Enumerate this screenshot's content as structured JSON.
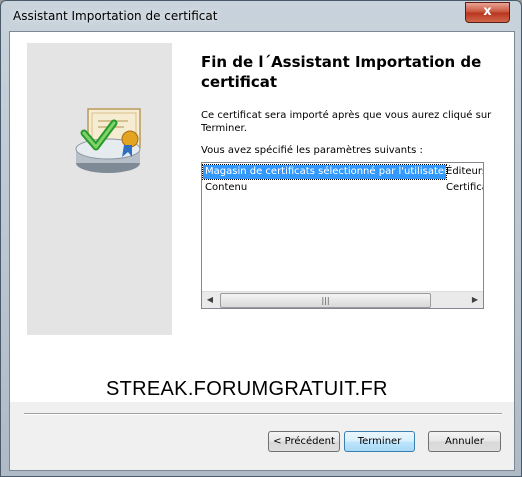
{
  "window": {
    "title": "Assistant Importation de certificat",
    "close_glyph": "x"
  },
  "wizard": {
    "heading": "Fin de l´Assistant Importation de certificat",
    "description": "Ce certificat sera importé après que vous aurez cliqué sur Terminer.",
    "params_label": "Vous avez spécifié les paramètres suivants :",
    "settings": [
      {
        "name": "Magasin de certificats sélectionné par l'utilisateur",
        "value": "Éditeurs"
      },
      {
        "name": "Contenu",
        "value": "Certificat"
      }
    ],
    "illustration_icon": "certificate-import-icon"
  },
  "watermark": "STREAK.FORUMGRATUIT.FR",
  "buttons": {
    "back": "< Précédent",
    "finish": "Terminer",
    "cancel": "Annuler"
  },
  "colors": {
    "selection": "#3399ff",
    "close_button": "#c7503a"
  }
}
